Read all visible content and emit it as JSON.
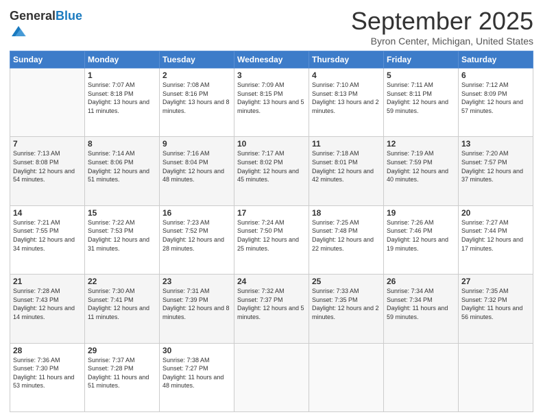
{
  "header": {
    "logo_general": "General",
    "logo_blue": "Blue",
    "month_title": "September 2025",
    "location": "Byron Center, Michigan, United States"
  },
  "days_of_week": [
    "Sunday",
    "Monday",
    "Tuesday",
    "Wednesday",
    "Thursday",
    "Friday",
    "Saturday"
  ],
  "weeks": [
    [
      {
        "num": "",
        "sunrise": "",
        "sunset": "",
        "daylight": ""
      },
      {
        "num": "1",
        "sunrise": "Sunrise: 7:07 AM",
        "sunset": "Sunset: 8:18 PM",
        "daylight": "Daylight: 13 hours and 11 minutes."
      },
      {
        "num": "2",
        "sunrise": "Sunrise: 7:08 AM",
        "sunset": "Sunset: 8:16 PM",
        "daylight": "Daylight: 13 hours and 8 minutes."
      },
      {
        "num": "3",
        "sunrise": "Sunrise: 7:09 AM",
        "sunset": "Sunset: 8:15 PM",
        "daylight": "Daylight: 13 hours and 5 minutes."
      },
      {
        "num": "4",
        "sunrise": "Sunrise: 7:10 AM",
        "sunset": "Sunset: 8:13 PM",
        "daylight": "Daylight: 13 hours and 2 minutes."
      },
      {
        "num": "5",
        "sunrise": "Sunrise: 7:11 AM",
        "sunset": "Sunset: 8:11 PM",
        "daylight": "Daylight: 12 hours and 59 minutes."
      },
      {
        "num": "6",
        "sunrise": "Sunrise: 7:12 AM",
        "sunset": "Sunset: 8:09 PM",
        "daylight": "Daylight: 12 hours and 57 minutes."
      }
    ],
    [
      {
        "num": "7",
        "sunrise": "Sunrise: 7:13 AM",
        "sunset": "Sunset: 8:08 PM",
        "daylight": "Daylight: 12 hours and 54 minutes."
      },
      {
        "num": "8",
        "sunrise": "Sunrise: 7:14 AM",
        "sunset": "Sunset: 8:06 PM",
        "daylight": "Daylight: 12 hours and 51 minutes."
      },
      {
        "num": "9",
        "sunrise": "Sunrise: 7:16 AM",
        "sunset": "Sunset: 8:04 PM",
        "daylight": "Daylight: 12 hours and 48 minutes."
      },
      {
        "num": "10",
        "sunrise": "Sunrise: 7:17 AM",
        "sunset": "Sunset: 8:02 PM",
        "daylight": "Daylight: 12 hours and 45 minutes."
      },
      {
        "num": "11",
        "sunrise": "Sunrise: 7:18 AM",
        "sunset": "Sunset: 8:01 PM",
        "daylight": "Daylight: 12 hours and 42 minutes."
      },
      {
        "num": "12",
        "sunrise": "Sunrise: 7:19 AM",
        "sunset": "Sunset: 7:59 PM",
        "daylight": "Daylight: 12 hours and 40 minutes."
      },
      {
        "num": "13",
        "sunrise": "Sunrise: 7:20 AM",
        "sunset": "Sunset: 7:57 PM",
        "daylight": "Daylight: 12 hours and 37 minutes."
      }
    ],
    [
      {
        "num": "14",
        "sunrise": "Sunrise: 7:21 AM",
        "sunset": "Sunset: 7:55 PM",
        "daylight": "Daylight: 12 hours and 34 minutes."
      },
      {
        "num": "15",
        "sunrise": "Sunrise: 7:22 AM",
        "sunset": "Sunset: 7:53 PM",
        "daylight": "Daylight: 12 hours and 31 minutes."
      },
      {
        "num": "16",
        "sunrise": "Sunrise: 7:23 AM",
        "sunset": "Sunset: 7:52 PM",
        "daylight": "Daylight: 12 hours and 28 minutes."
      },
      {
        "num": "17",
        "sunrise": "Sunrise: 7:24 AM",
        "sunset": "Sunset: 7:50 PM",
        "daylight": "Daylight: 12 hours and 25 minutes."
      },
      {
        "num": "18",
        "sunrise": "Sunrise: 7:25 AM",
        "sunset": "Sunset: 7:48 PM",
        "daylight": "Daylight: 12 hours and 22 minutes."
      },
      {
        "num": "19",
        "sunrise": "Sunrise: 7:26 AM",
        "sunset": "Sunset: 7:46 PM",
        "daylight": "Daylight: 12 hours and 19 minutes."
      },
      {
        "num": "20",
        "sunrise": "Sunrise: 7:27 AM",
        "sunset": "Sunset: 7:44 PM",
        "daylight": "Daylight: 12 hours and 17 minutes."
      }
    ],
    [
      {
        "num": "21",
        "sunrise": "Sunrise: 7:28 AM",
        "sunset": "Sunset: 7:43 PM",
        "daylight": "Daylight: 12 hours and 14 minutes."
      },
      {
        "num": "22",
        "sunrise": "Sunrise: 7:30 AM",
        "sunset": "Sunset: 7:41 PM",
        "daylight": "Daylight: 12 hours and 11 minutes."
      },
      {
        "num": "23",
        "sunrise": "Sunrise: 7:31 AM",
        "sunset": "Sunset: 7:39 PM",
        "daylight": "Daylight: 12 hours and 8 minutes."
      },
      {
        "num": "24",
        "sunrise": "Sunrise: 7:32 AM",
        "sunset": "Sunset: 7:37 PM",
        "daylight": "Daylight: 12 hours and 5 minutes."
      },
      {
        "num": "25",
        "sunrise": "Sunrise: 7:33 AM",
        "sunset": "Sunset: 7:35 PM",
        "daylight": "Daylight: 12 hours and 2 minutes."
      },
      {
        "num": "26",
        "sunrise": "Sunrise: 7:34 AM",
        "sunset": "Sunset: 7:34 PM",
        "daylight": "Daylight: 11 hours and 59 minutes."
      },
      {
        "num": "27",
        "sunrise": "Sunrise: 7:35 AM",
        "sunset": "Sunset: 7:32 PM",
        "daylight": "Daylight: 11 hours and 56 minutes."
      }
    ],
    [
      {
        "num": "28",
        "sunrise": "Sunrise: 7:36 AM",
        "sunset": "Sunset: 7:30 PM",
        "daylight": "Daylight: 11 hours and 53 minutes."
      },
      {
        "num": "29",
        "sunrise": "Sunrise: 7:37 AM",
        "sunset": "Sunset: 7:28 PM",
        "daylight": "Daylight: 11 hours and 51 minutes."
      },
      {
        "num": "30",
        "sunrise": "Sunrise: 7:38 AM",
        "sunset": "Sunset: 7:27 PM",
        "daylight": "Daylight: 11 hours and 48 minutes."
      },
      {
        "num": "",
        "sunrise": "",
        "sunset": "",
        "daylight": ""
      },
      {
        "num": "",
        "sunrise": "",
        "sunset": "",
        "daylight": ""
      },
      {
        "num": "",
        "sunrise": "",
        "sunset": "",
        "daylight": ""
      },
      {
        "num": "",
        "sunrise": "",
        "sunset": "",
        "daylight": ""
      }
    ]
  ]
}
